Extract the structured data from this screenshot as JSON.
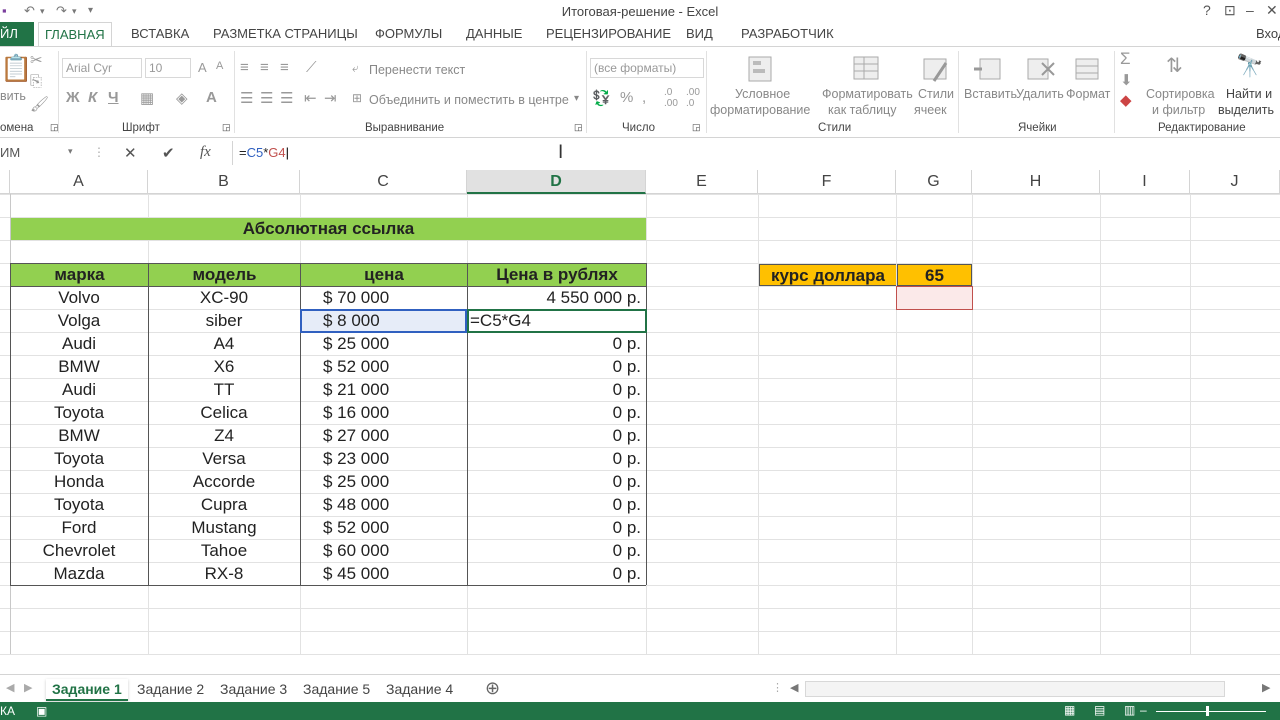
{
  "titlebar": {
    "title": "Итоговая-решение - Excel",
    "help": "?",
    "minimize": "–",
    "restore": "❐",
    "close": "✕"
  },
  "tabs": {
    "file": "ЙЛ",
    "items": [
      "ГЛАВНАЯ",
      "ВСТАВКА",
      "РАЗМЕТКА СТРАНИЦЫ",
      "ФОРМУЛЫ",
      "ДАННЫЕ",
      "РЕЦЕНЗИРОВАНИЕ",
      "ВИД",
      "РАЗРАБОТЧИК"
    ],
    "signin": "Вход"
  },
  "ribbon": {
    "clipboard": {
      "paste": "вить",
      "label": "омена"
    },
    "font": {
      "name": "Arial Cyr",
      "size": "10",
      "bold": "Ж",
      "italic": "К",
      "underline": "Ч",
      "label": "Шрифт"
    },
    "alignment": {
      "wrap": "Перенести текст",
      "merge": "Объединить и поместить в центре",
      "label": "Выравнивание"
    },
    "number": {
      "format": "(все форматы)",
      "label": "Число"
    },
    "styles": {
      "cond1": "Условное",
      "cond2": "форматирование",
      "fmt1": "Форматировать",
      "fmt2": "как таблицу",
      "cell1": "Стили",
      "cell2": "ячеек",
      "label": "Стили"
    },
    "cells": {
      "insert": "Вставить",
      "delete": "Удалить",
      "format": "Формат",
      "label": "Ячейки"
    },
    "editing": {
      "sort1": "Сортировка",
      "sort2": "и фильтр",
      "find1": "Найти и",
      "find2": "выделить",
      "label": "Редактирование"
    }
  },
  "formulabar": {
    "namebox": "ИМ",
    "cancel": "✕",
    "enter": "✔",
    "fx": "fx",
    "f_eq": "=",
    "f_ref1": "C5",
    "f_op": "*",
    "f_ref2": "G4"
  },
  "columns": [
    "A",
    "B",
    "C",
    "D",
    "E",
    "F",
    "G",
    "H",
    "I",
    "J"
  ],
  "sheet": {
    "title": "Абсолютная ссылка",
    "headers": [
      "марка",
      "модель",
      "цена",
      "Цена в рублях"
    ],
    "rows": [
      [
        "Volvo",
        "XC-90",
        "$ 70 000",
        "4 550 000 р."
      ],
      [
        "Volga",
        "siber",
        "$ 8 000",
        "=C5*G4"
      ],
      [
        "Audi",
        "A4",
        "$ 25 000",
        "0 р."
      ],
      [
        "BMW",
        "X6",
        "$ 52 000",
        "0 р."
      ],
      [
        "Audi",
        "TT",
        "$ 21 000",
        "0 р."
      ],
      [
        "Toyota",
        "Celica",
        "$ 16 000",
        "0 р."
      ],
      [
        "BMW",
        "Z4",
        "$ 27 000",
        "0 р."
      ],
      [
        "Toyota",
        "Versa",
        "$ 23 000",
        "0 р."
      ],
      [
        "Honda",
        "Accorde",
        "$ 25 000",
        "0 р."
      ],
      [
        "Toyota",
        "Cupra",
        "$ 48 000",
        "0 р."
      ],
      [
        "Ford",
        "Mustang",
        "$ 52 000",
        "0 р."
      ],
      [
        "Chevrolet",
        "Tahoe",
        "$ 60 000",
        "0 р."
      ],
      [
        "Mazda",
        "RX-8",
        "$ 45 000",
        "0 р."
      ]
    ],
    "rate_label": "курс доллара",
    "rate_value": "65"
  },
  "sheettabs": [
    "Задание 1",
    "Задание 2",
    "Задание 3",
    "Задание 5",
    "Задание 4"
  ],
  "status": {
    "mode": "КА"
  },
  "colors": {
    "excel_green": "#217346",
    "header_green": "#92d050",
    "rate_orange": "#ffc000",
    "ref_blue": "#3060c0",
    "ref_red": "#c0504d"
  }
}
